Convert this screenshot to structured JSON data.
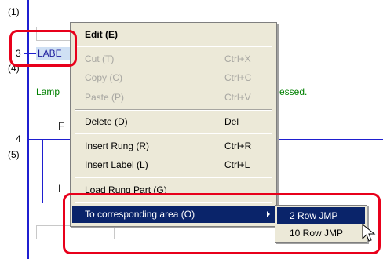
{
  "ladder": {
    "row_numbers": [
      "(1)",
      "3",
      "(4)",
      "4",
      "(5)"
    ],
    "label_chip": "LABE",
    "comment_left": "Lamp",
    "comment_right": "essed.",
    "partial_letters": [
      "F",
      "L"
    ]
  },
  "context_menu": {
    "items": [
      {
        "label": "Edit (E)",
        "shortcut": "",
        "enabled": true,
        "bold": true
      },
      {
        "label": "Cut (T)",
        "shortcut": "Ctrl+X",
        "enabled": false
      },
      {
        "label": "Copy (C)",
        "shortcut": "Ctrl+C",
        "enabled": false
      },
      {
        "label": "Paste (P)",
        "shortcut": "Ctrl+V",
        "enabled": false
      },
      {
        "label": "Delete (D)",
        "shortcut": "Del",
        "enabled": true
      },
      {
        "label": "Insert Rung (R)",
        "shortcut": "Ctrl+R",
        "enabled": true
      },
      {
        "label": "Insert Label (L)",
        "shortcut": "Ctrl+L",
        "enabled": true
      },
      {
        "label": "Load Rung Part (G)",
        "shortcut": "",
        "enabled": true
      },
      {
        "label": "To corresponding area (O)",
        "shortcut": "",
        "enabled": true,
        "selected": true,
        "has_submenu": true
      }
    ]
  },
  "submenu": {
    "items": [
      {
        "label": "2 Row JMP",
        "selected": true
      },
      {
        "label": "10 Row JMP",
        "selected": false
      }
    ]
  },
  "colors": {
    "rail": "#1f1fd0",
    "highlight_border": "#e8001b",
    "menu_selection": "#0a246a",
    "comment_text": "#008000"
  },
  "icons": [
    "mouse-cursor-icon",
    "submenu-arrow-icon"
  ]
}
